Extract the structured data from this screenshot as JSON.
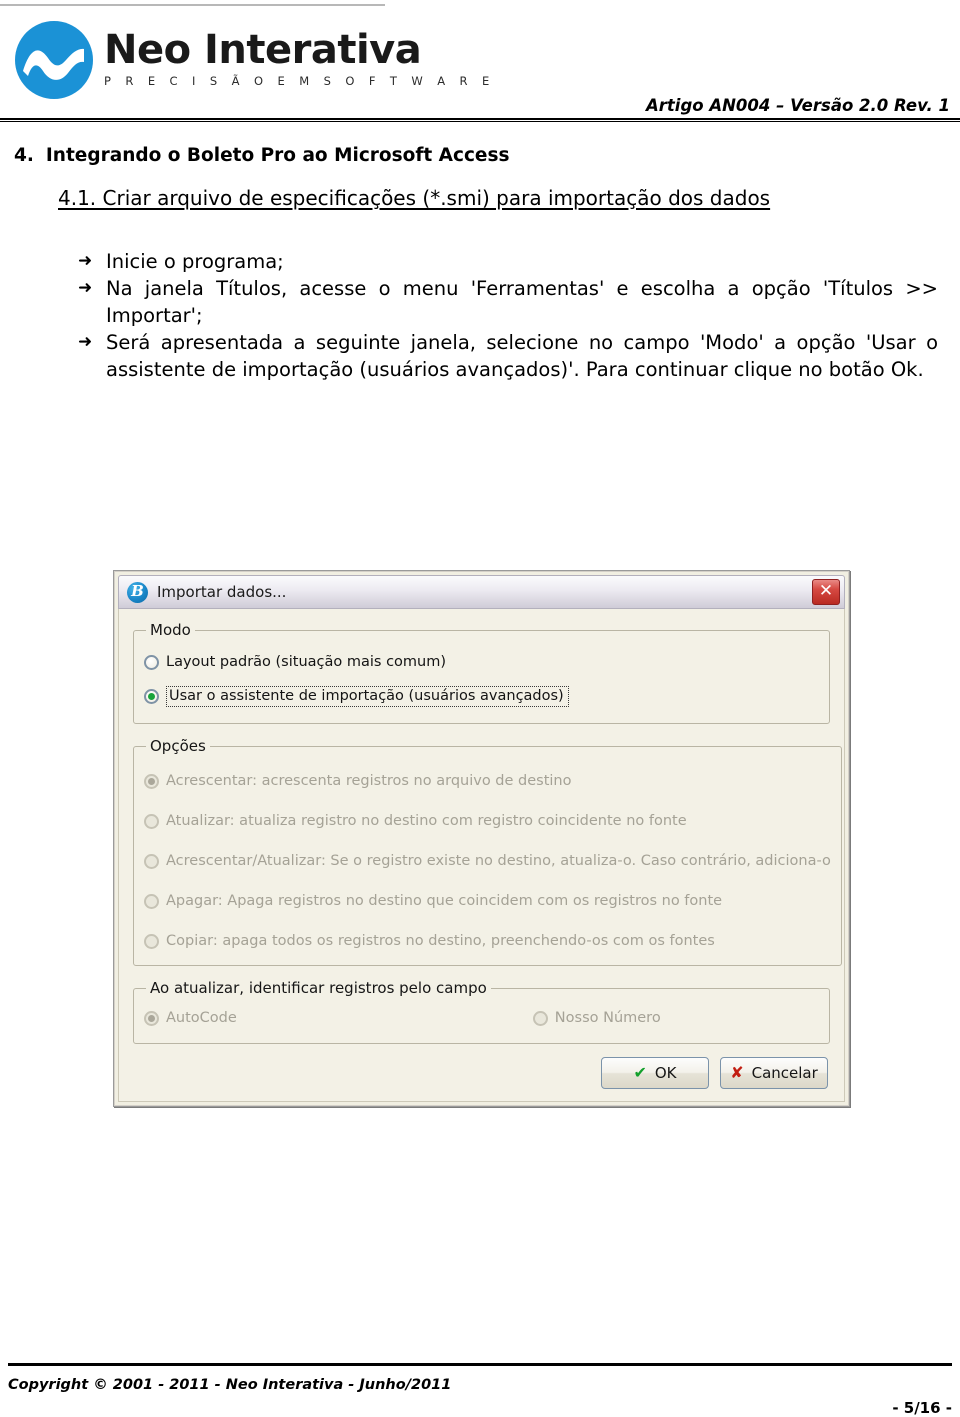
{
  "header": {
    "logo": {
      "mark": "neo-wave-circle",
      "name": "Neo Interativa",
      "tagline": "P R E C I S Ã O   E M   S O F T W A R E",
      "color": "#1b92d6"
    },
    "doc_ref": "Artigo AN004 – Versão 2.0 Rev. 1"
  },
  "content": {
    "section_number": "4.",
    "section_title": "Integrando o Boleto Pro ao Microsoft Access",
    "subsection_title": "4.1. Criar arquivo de especificações (*.smi) para importação dos dados",
    "bullets": [
      "Inicie o programa;",
      "Na janela Títulos, acesse o menu 'Ferramentas' e escolha a opção 'Títulos >> Importar';",
      "Será apresentada a seguinte janela, selecione no campo 'Modo' a opção 'Usar o assistente de importação (usuários avançados)'. Para continuar clique no botão Ok.",
      ""
    ],
    "bullet_glyph": "➜"
  },
  "dialog": {
    "title": "Importar dados...",
    "icon": "boleto-b-icon",
    "icon_glyph": "B",
    "close_label": "✕",
    "modo": {
      "legend": "Modo",
      "options": [
        {
          "label": "Layout padrão (situação mais comum)",
          "selected": false,
          "disabled": false,
          "focused": false
        },
        {
          "label": "Usar o assistente de importação (usuários avançados)",
          "selected": true,
          "disabled": false,
          "focused": true
        }
      ]
    },
    "opcoes": {
      "legend": "Opções",
      "options": [
        {
          "label": "Acrescentar: acrescenta registros no arquivo de destino",
          "selected": true,
          "disabled": true
        },
        {
          "label": "Atualizar: atualiza registro no destino com registro coincidente no fonte",
          "selected": false,
          "disabled": true
        },
        {
          "label": "Acrescentar/Atualizar: Se o registro existe no destino, atualiza-o. Caso contrário, adiciona-o",
          "selected": false,
          "disabled": true
        },
        {
          "label": "Apagar: Apaga registros no destino que coincidem com os registros no fonte",
          "selected": false,
          "disabled": true
        },
        {
          "label": "Copiar: apaga todos os registros no destino, preenchendo-os com os fontes",
          "selected": false,
          "disabled": true
        }
      ]
    },
    "campo": {
      "legend": "Ao atualizar, identificar registros pelo campo",
      "options": [
        {
          "label": "AutoCode",
          "selected": true,
          "disabled": true
        },
        {
          "label": "Nosso Número",
          "selected": false,
          "disabled": true
        }
      ]
    },
    "buttons": {
      "ok": {
        "label": "OK",
        "glyph": "✔",
        "color": "#13a02c"
      },
      "cancel": {
        "label": "Cancelar",
        "glyph": "✘",
        "color": "#c21d12"
      }
    }
  },
  "footer": {
    "copyright": "Copyright © 2001 - 2011 - Neo Interativa - Junho/2011",
    "page": "- 5/16 -"
  }
}
